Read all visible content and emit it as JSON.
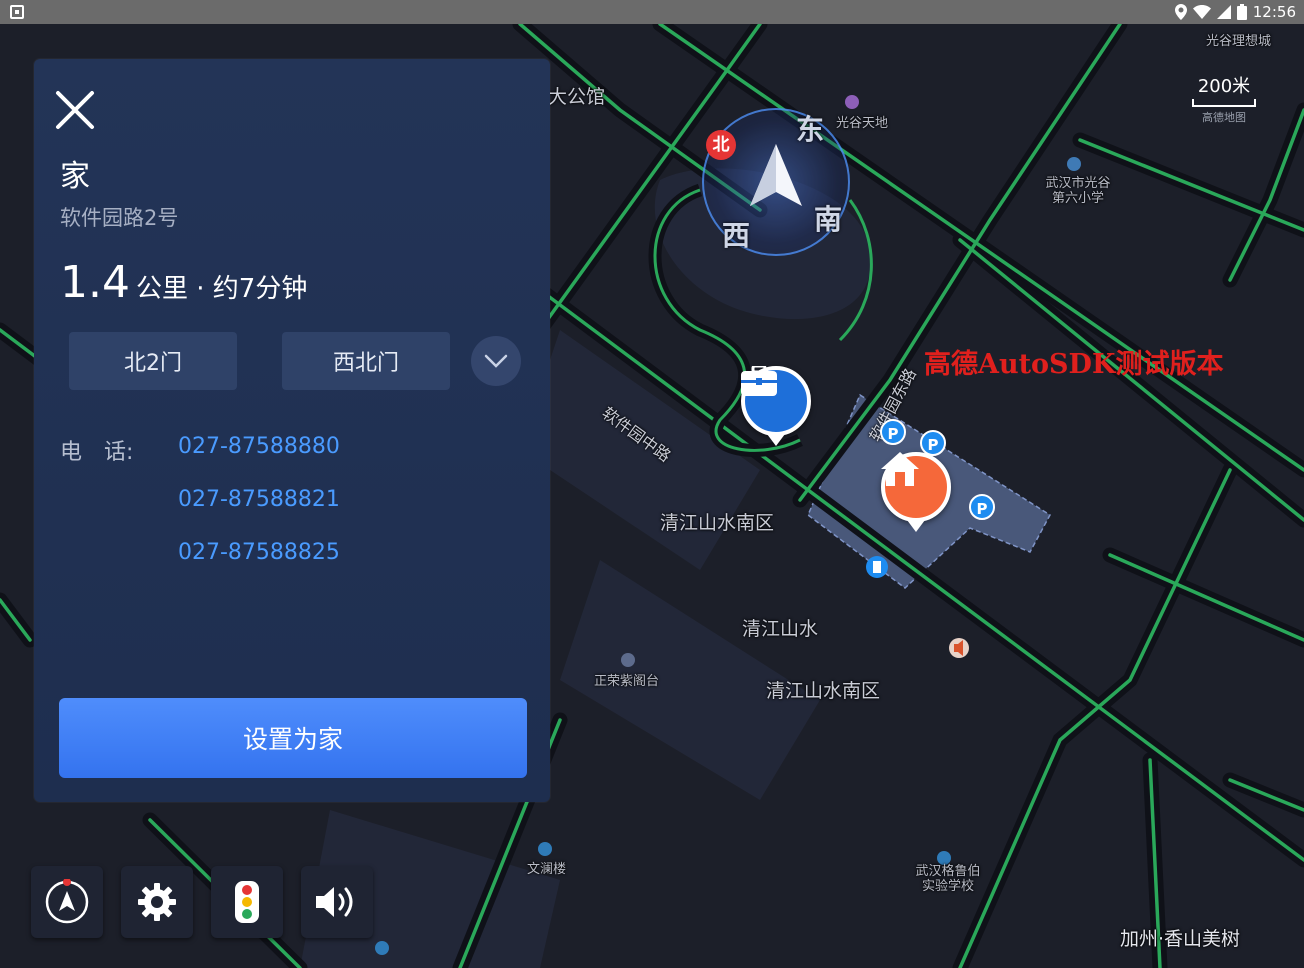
{
  "status_bar": {
    "time": "12:56",
    "icons": [
      "notification-icon",
      "location-icon",
      "wifi-icon",
      "signal-icon",
      "battery-icon"
    ]
  },
  "map": {
    "scale_label": "200米",
    "scale_sub": "高德地图",
    "watermark": "高德AutoSDK测试版本",
    "compass": {
      "north": "北",
      "east": "东",
      "west": "西",
      "south": "南"
    },
    "labels": [
      "光谷理想城",
      "大公馆",
      "光谷天地",
      "武汉市光谷第六小学",
      "软件园中路",
      "软件园东路",
      "清江山水南区",
      "清江山水",
      "清江山水南区",
      "正荣紫阁台",
      "文澜楼",
      "武汉格鲁伯实验学校",
      "加州·香山美树"
    ]
  },
  "panel": {
    "title": "家",
    "address": "软件园路2号",
    "distance_value": "1.4",
    "distance_text": "公里 · 约7分钟",
    "gates": [
      "北2门",
      "西北门"
    ],
    "phone_label": "电　话:",
    "phones": [
      "027-87588880",
      "027-87588821",
      "027-87588825"
    ],
    "set_home_label": "设置为家"
  },
  "controls": [
    "compass-mode-icon",
    "settings-icon",
    "traffic-light-icon",
    "volume-icon"
  ],
  "colors": {
    "panel_bg": "#233457",
    "accent_blue": "#3d7ef5",
    "link_blue": "#4a9bff",
    "road_green": "#2aa85a",
    "watermark_red": "#e0201d",
    "home_marker": "#f5683a",
    "work_marker": "#1e6fd9"
  }
}
